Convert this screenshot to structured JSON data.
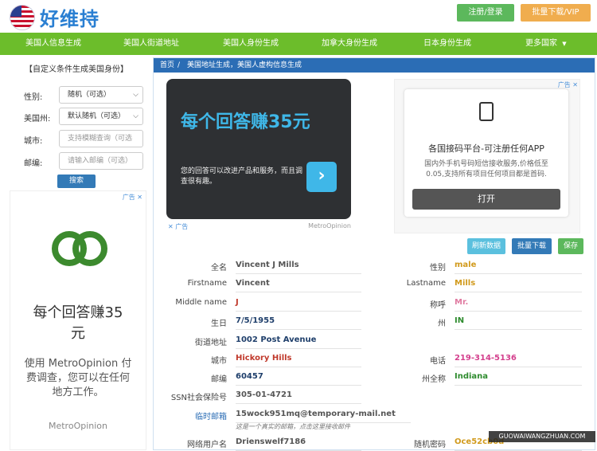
{
  "header": {
    "logo_text": "好维持",
    "register_button": "注册/登录",
    "vip_button": "批量下载/VIP"
  },
  "nav": {
    "items": [
      "美国人信息生成",
      "美国人街道地址",
      "美国人身份生成",
      "加拿大身份生成",
      "日本身份生成",
      "更多国家"
    ]
  },
  "sidebar": {
    "title": "【自定义条件生成美国身份】",
    "gender_label": "性别:",
    "gender_value": "随机（可选）",
    "state_label": "美国州:",
    "state_value": "默认随机（可选）",
    "city_label": "城市:",
    "city_placeholder": "支持模糊查询（可选",
    "zip_label": "邮编:",
    "zip_placeholder": "请输入邮编（可选）",
    "search_button": "搜索"
  },
  "ad_left": {
    "headline": "每个回答赚35元",
    "body": "使用 MetroOpinion 付费调查，您可以在任何地方工作。",
    "brand": "MetroOpinion",
    "ad_label": "广告"
  },
  "breadcrumb": {
    "home": "首页",
    "separator": "/",
    "current": "美国地址生成，美国人虚构信息生成"
  },
  "ad_dark": {
    "headline": "每个回答赚35元",
    "body": "您的回答可以改进产品和服务，而且调查很有趣。",
    "ad_label": "广告",
    "brand": "MetroOpinion"
  },
  "ad_right": {
    "ad_label": "广告",
    "title": "各国接码平台-可注册任何APP",
    "body": "国内外手机号码短信接收服务,价格低至0.05,支持所有项目任何项目都是首码.",
    "open_button": "打开"
  },
  "actions": {
    "refresh": "刷新数据",
    "batch": "批量下载",
    "save": "保存"
  },
  "fields": {
    "fullname_label": "全名",
    "fullname": "Vincent J Mills",
    "gender_label": "性别",
    "gender": "male",
    "firstname_label": "Firstname",
    "firstname": "Vincent",
    "lastname_label": "Lastname",
    "lastname": "Mills",
    "middle_label": "Middle name",
    "middle": "J",
    "title_label": "称呼",
    "title": "Mr.",
    "birthday_label": "生日",
    "birthday": "7/5/1955",
    "state_label": "州",
    "state": "IN",
    "street_label": "街道地址",
    "street": "1002 Post Avenue",
    "city_label": "城市",
    "city": "Hickory Hills",
    "phone_label": "电话",
    "phone": "219-314-5136",
    "zip_label": "邮编",
    "zip": "60457",
    "state_full_label": "州全称",
    "state_full": "Indiana",
    "ssn_label": "SSN社会保险号",
    "ssn": "305-01-4721",
    "email_label": "临时邮箱",
    "email": "15wock951mq@temporary-mail.net",
    "email_note": "这是一个真实的邮箱，点击这里接收邮件",
    "username_label": "网络用户名",
    "username": "Drienswelf7186",
    "password_label": "随机密码",
    "password": "Oce52cb0d"
  },
  "watermark": "GUOWAIWANGZHUAN.COM",
  "colors": {
    "nav_green": "#6cbd2b",
    "breadcrumb_blue": "#2b6db5",
    "value_red": "#c0392b",
    "value_orange": "#d19a1c",
    "value_green": "#2e8b2e",
    "value_blue": "#1f3f6b"
  }
}
